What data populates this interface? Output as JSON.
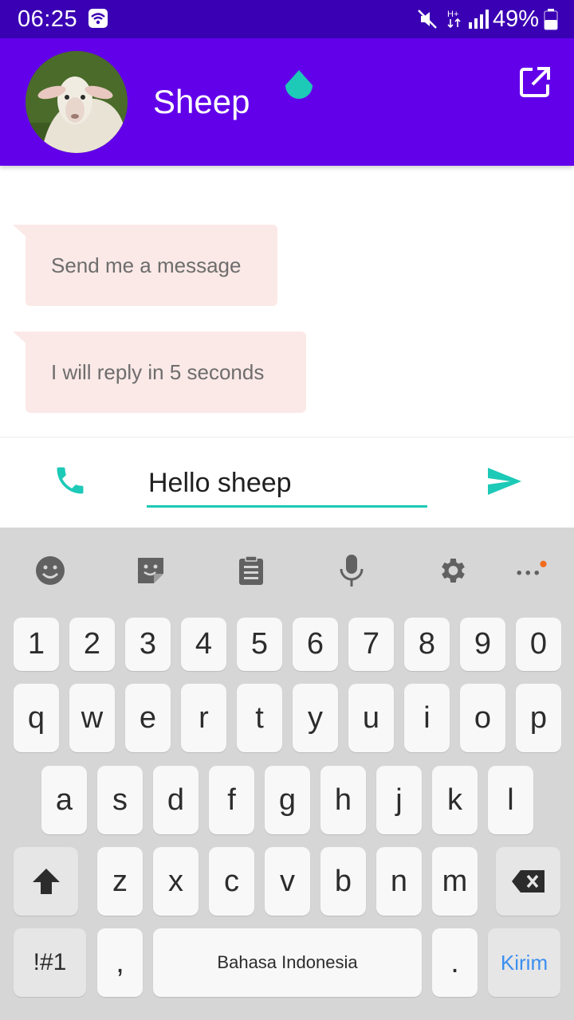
{
  "status_bar": {
    "time": "06:25",
    "battery": "49%",
    "icons": [
      "wifi-icon",
      "mute-icon",
      "data-arrows-icon",
      "signal-icon",
      "battery-icon"
    ]
  },
  "app_bar": {
    "title": "Sheep",
    "avatar_icon": "sheep-avatar",
    "action_icon": "open-in-new-icon",
    "color": "#6200ea"
  },
  "messages": [
    {
      "text": "Send me a message"
    },
    {
      "text": "I will reply in 5 seconds"
    }
  ],
  "composer": {
    "input_value": "Hello sheep",
    "accent_color": "#1dc9b7",
    "call_icon": "phone-icon",
    "send_icon": "send-icon"
  },
  "keyboard": {
    "toolbar": [
      "emoji-icon",
      "sticker-icon",
      "clipboard-icon",
      "microphone-icon",
      "settings-icon",
      "more-icon"
    ],
    "numbers": [
      "1",
      "2",
      "3",
      "4",
      "5",
      "6",
      "7",
      "8",
      "9",
      "0"
    ],
    "row1": [
      "q",
      "w",
      "e",
      "r",
      "t",
      "y",
      "u",
      "i",
      "o",
      "p"
    ],
    "row2": [
      "a",
      "s",
      "d",
      "f",
      "g",
      "h",
      "j",
      "k",
      "l"
    ],
    "row3": [
      "z",
      "x",
      "c",
      "v",
      "b",
      "n",
      "m"
    ],
    "symbols_label": "!#1",
    "comma_label": ",",
    "space_label": "Bahasa Indonesia",
    "period_label": ".",
    "enter_label": "Kirim"
  }
}
